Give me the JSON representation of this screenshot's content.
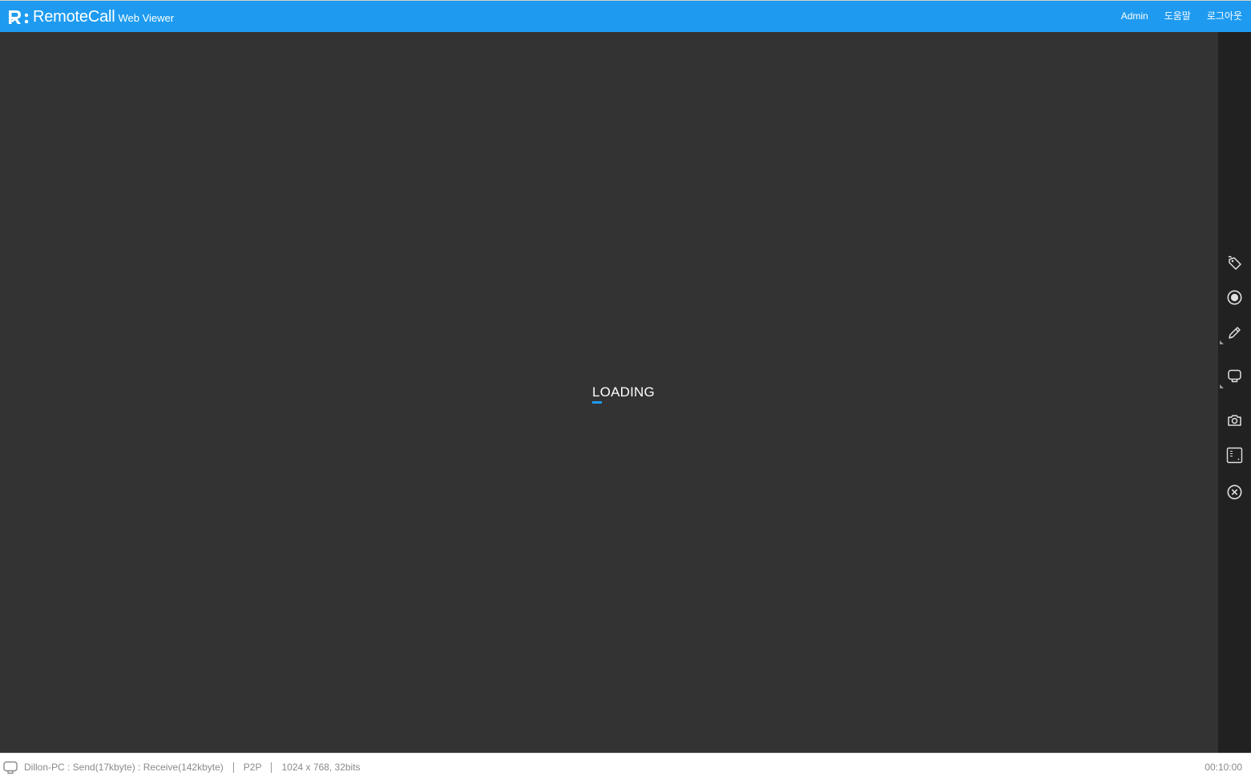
{
  "header": {
    "logo_text": "RemoteCall",
    "logo_sub": "Web Viewer",
    "nav": {
      "admin": "Admin",
      "help": "도움말",
      "logout": "로그아웃"
    }
  },
  "viewport": {
    "loading_text": "LOADING"
  },
  "toolbar": {
    "tools": [
      {
        "name": "tag-icon"
      },
      {
        "name": "record-icon"
      },
      {
        "name": "pen-icon"
      },
      {
        "name": "monitor-icon"
      },
      {
        "name": "camera-icon"
      },
      {
        "name": "ctrl-alt-del-icon"
      },
      {
        "name": "close-circle-icon"
      }
    ]
  },
  "status": {
    "connection": "Dillon-PC : Send(17kbyte) : Receive(142kbyte)",
    "mode": "P2P",
    "resolution": "1024 x 768, 32bits",
    "elapsed": "00:10:00"
  },
  "colors": {
    "header_bg": "#1e9bf0",
    "viewport_bg": "#333333",
    "toolbar_bg": "#212121",
    "accent": "#1e9bf0"
  }
}
